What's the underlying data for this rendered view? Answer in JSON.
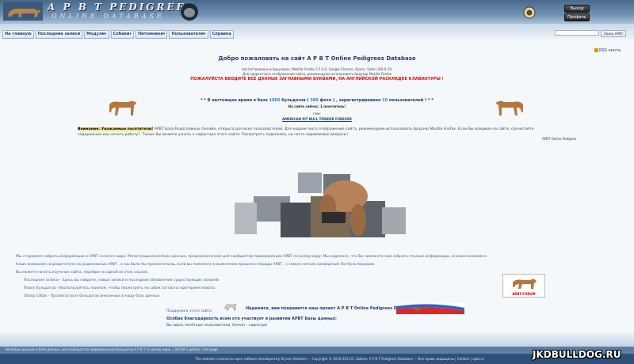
{
  "header": {
    "title": "A P B T  PEDIGREES",
    "subtitle": "ONLINE DATABASE",
    "logout_label": "Выход",
    "profile_label": "Профиль"
  },
  "nav": {
    "items": [
      {
        "label": "На главную"
      },
      {
        "label": "Последние записи"
      },
      {
        "label": "Модули▾"
      },
      {
        "label": "Собаки▾"
      },
      {
        "label": "Питомники▾"
      },
      {
        "label": "Пользователи▾"
      },
      {
        "label": "Справка"
      }
    ],
    "search_button": "Поиск APBT",
    "search_value": ""
  },
  "rss_label": "RSS лента",
  "main": {
    "welcome": "Добро пожаловать на сайт A P B T Online Pedigrees Database",
    "tested": "протестировано в браузерах: Mozilla Firefox 1.5-3.0, Google Chrome, Opera, Safari, IE6-9-10.",
    "recommend": "Для корректного отображения сайта, рекомендуем использовать браузер Mozilla Firefox",
    "warning": "ПОЖАЛУЙСТА ВВОДИТЕ ВСЕ ДАННЫЕ ЗАГЛАВНЫМИ БУКВАМИ, НА АНГЛИЙСКОЙ РАСКЛАДКЕ КЛАВИАТУРЫ !",
    "stats_prefix": "* * В настоящее время в базе",
    "stats_dogs": "1860",
    "stats_mid": "бульдогов (",
    "stats_photos": "390",
    "stats_mid2": "фото ) , зарегистрировано",
    "stats_users": "10",
    "stats_suffix": "пользователей ! * *",
    "online": "На сайте сейчас: 1 посетитель!",
    "new_label": "new:",
    "forever": "AMERICAN PIT BULL TERRIER FOREVER",
    "attention_bold": "Внимание: Уважаемые посетители!",
    "attention_text": "APBT База Родословных Онлайн, открыта для всех пользователей. Для корректного отображения сайта, рекомендуем использовать браузер Mozilla Firefox. Если Вы впервые на сайте, прочитайте содержание как начать работу?. Также Вы можете узнать о характере этого сайта. Посмотреть подсказки, на часто задаваемые вопросы!",
    "signature": "APBT Online Pedigree"
  },
  "info": {
    "line1": "Мы стараемся собрать информацию о APBT со всего мира. Регистрационная база данных, предназначенная для сообщества приверженцев APBT по всему миру. Мы надеемся, что Вы поможете нам собрать столько информации, сколько возможно.",
    "line2": "Наше внимание сосредоточено на родословных APBT , и мы были бы признательны, если вы поможете в выяснении прошлого породы APBT , с самого начала разведения Питбультерьеров.",
    "line3": "Вы можете начать изучение сайта, перейдя по одной из этих ссылок:",
    "link1": "Последние записи - Здесь вы найдете, новые записи и последние обновления существующих записей.",
    "link2": "Поиск бульдогов - Воспользуйтесь поиском, чтобы посмотреть на собак согласно критериям поиска.",
    "link3": "Обзор собак - Просмотр всех бульдогов внесенных в нашу базу данных."
  },
  "forum_label": "APBT-FORUM",
  "support": {
    "label": "Поддержка этого сайта",
    "hope": "Надеемся, вам понравится наш проект A P B T Online Pedigrees Database!",
    "thanks": "Особая благодарность всем кто участвует в развитии APBT Базы данных:",
    "honor": "Вы здесь почётные пользователи, forever - навсегда!"
  },
  "footer": {
    "line1": "Числовые данные в базе данных, для сообщества приверженцев бульдогов A P B T по всему миру. | 3D Ball | gallery | last page",
    "line2": "This website is based on open software developed by Ulysse Villadiner — Copyright © 2010-2013 D. Zaitsev. A P B T Pedigrees Database — Все права защищены | Contact | apbt.ru",
    "watermark": "JKDBULLDOG.RU"
  }
}
